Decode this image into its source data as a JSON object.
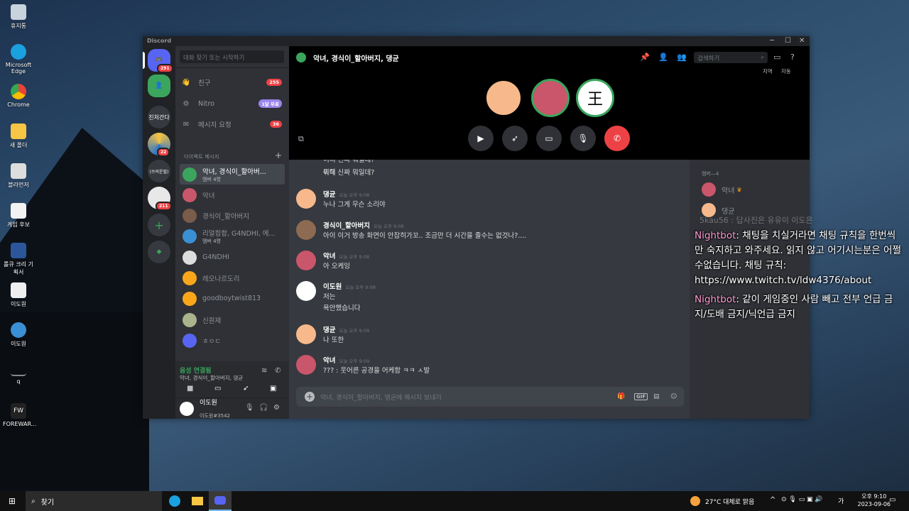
{
  "desktop": {
    "icons": [
      "휴지통",
      "Microsoft Edge",
      "Chrome",
      "새 폴더",
      "블라먼저",
      "게임 후보",
      "롤큐 크리 기획서",
      "이도원",
      "이도원",
      "q",
      "FOREWAR..."
    ]
  },
  "window": {
    "app_title": "Discord",
    "minimize": "─",
    "maximize": "☐",
    "close": "✕"
  },
  "guilds": {
    "home_badge": "291",
    "friends_badge": "",
    "server_text_1": "친처간다",
    "server_badge_2": "22",
    "server_text_3": "(쓰의운필)",
    "server_badge_4": "211",
    "add_label": "+",
    "explore_label": "◆"
  },
  "sidebar": {
    "search_placeholder": "대화 찾기 또는 시작하기",
    "nav": [
      {
        "label": "친구",
        "badge": "255"
      },
      {
        "label": "Nitro",
        "badge": "1달 무료"
      },
      {
        "label": "메시지 요청",
        "badge": "36"
      }
    ],
    "dm_header": "다이렉트 메시지",
    "dm_add": "+",
    "dms": [
      {
        "name": "악녀, 경식이_할아버...",
        "sub": "멤버 4명"
      },
      {
        "name": "악녀",
        "sub": ""
      },
      {
        "name": "경식이_할아버지",
        "sub": ""
      },
      {
        "name": "리얼힙합, G4NDHI, 에...",
        "sub": "멤버 4명"
      },
      {
        "name": "G4NDHI",
        "sub": ""
      },
      {
        "name": "레오나르도리",
        "sub": ""
      },
      {
        "name": "goodboytwist813",
        "sub": ""
      },
      {
        "name": "신원재",
        "sub": ""
      },
      {
        "name": "ㅎㅇㄷ",
        "sub": ""
      }
    ],
    "voice_status": "음성 연결됨",
    "voice_channel": "악녀, 경식이_할아버지, 댕균",
    "user_name": "이도원",
    "user_tag": "이도원#3542"
  },
  "call": {
    "title": "악녀, 경식이_할아버지, 댕균",
    "search_placeholder": "검색하기",
    "region_label": "지역",
    "region_value": "자동"
  },
  "messages": [
    {
      "author": "",
      "time": "",
      "text": "이디 신짜 뭐일데?",
      "text2": "뭐해"
    },
    {
      "author": "댕균",
      "time": "오늘 오후 9:08",
      "text": "누나 그게 무슨 소리야",
      "text2": ""
    },
    {
      "author": "경식이_할아버지",
      "time": "오늘 오후 9:08",
      "text": "아이 이거 방송 화면이 안잡히가꼬.. 조금만 더 시간을 줄수는 없것나?....",
      "text2": ""
    },
    {
      "author": "악녀",
      "time": "오늘 오후 9:08",
      "text": "아 오케잉",
      "text2": ""
    },
    {
      "author": "이도원",
      "time": "오늘 오후 9:08",
      "text": "저는",
      "text2": "욕안했습니다"
    },
    {
      "author": "댕균",
      "time": "오늘 오후 9:09",
      "text": "나 또한",
      "text2": ""
    },
    {
      "author": "악녀",
      "time": "오늘 오후 9:09",
      "text": "??? : 웃어른 공경을 어케함 ㅋㅋ ㅅ발",
      "text2": ""
    }
  ],
  "composer": {
    "placeholder": "악녀, 경식이_할아버지, 댕균에 메시지 보내기",
    "gif": "GIF"
  },
  "members": {
    "header": "멤버—4",
    "list": [
      "악녀",
      "댕균"
    ]
  },
  "chat_overlay": {
    "ghost": "5kau56 : 답사진은 유유이 이도은",
    "lines": [
      {
        "user": "Nightbot",
        "text": ": 채팅을 치실거라면 채팅 규칙을 한번씩 만 숙지하고 와주세요. 읽지 않고 어기시는분은 어쩔수없습니다. 채팅 규칙: https://www.twitch.tv/ldw4376/about"
      },
      {
        "user": "Nightbot",
        "text": ": 같이 게임중인 사람 빼고 전부 언급 금지/도배 금지/닉언급 금지"
      }
    ]
  },
  "taskbar": {
    "search_label": "찾기",
    "weather": "27°C  대체로 맑음",
    "ime": "가",
    "time": "오후 9:10",
    "date": "2023-09-06"
  },
  "colors": {
    "blurple": "#5865f2",
    "green": "#3ba55d",
    "red": "#ed4245",
    "nitro": "#9b84ee"
  }
}
